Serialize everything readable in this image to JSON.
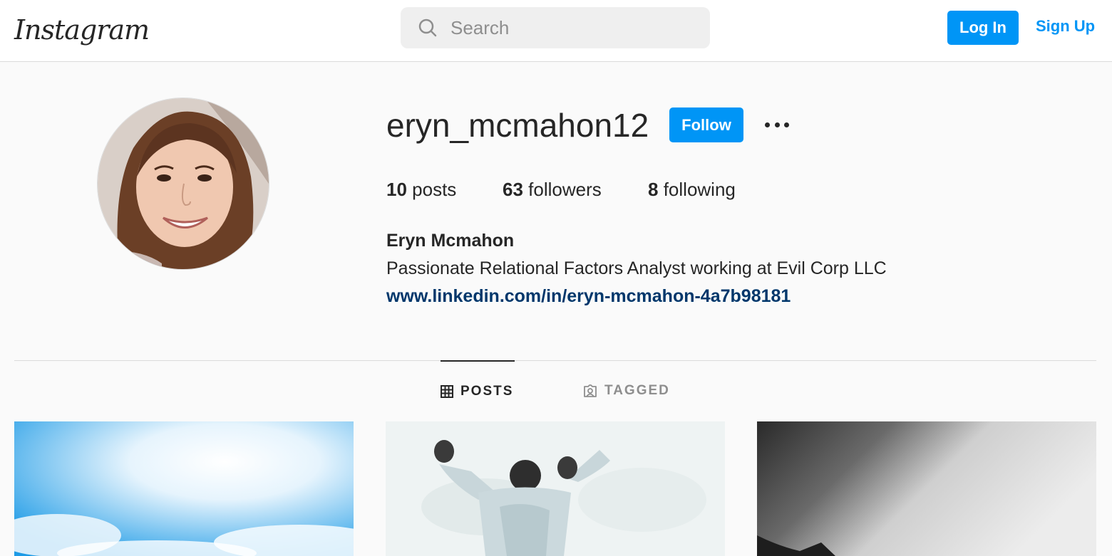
{
  "header": {
    "logo": "Instagram",
    "search_placeholder": "Search",
    "login_label": "Log In",
    "signup_label": "Sign Up"
  },
  "profile": {
    "username": "eryn_mcmahon12",
    "follow_label": "Follow",
    "more_icon": "more-options-icon",
    "stats": [
      {
        "count": "10",
        "label": "posts"
      },
      {
        "count": "63",
        "label": "followers"
      },
      {
        "count": "8",
        "label": "following"
      }
    ],
    "full_name": "Eryn Mcmahon",
    "bio": "Passionate Relational Factors Analyst working at Evil Corp LLC",
    "website": "www.linkedin.com/in/eryn-mcmahon-4a7b98181"
  },
  "tabs": [
    {
      "label": "POSTS",
      "icon": "grid-icon",
      "active": true
    },
    {
      "label": "TAGGED",
      "icon": "tagged-icon",
      "active": false
    }
  ],
  "colors": {
    "accent": "#0095f6",
    "link": "#00376b",
    "text": "#262626",
    "muted": "#8e8e8e",
    "background": "#fafafa",
    "border": "#dbdbdb"
  }
}
